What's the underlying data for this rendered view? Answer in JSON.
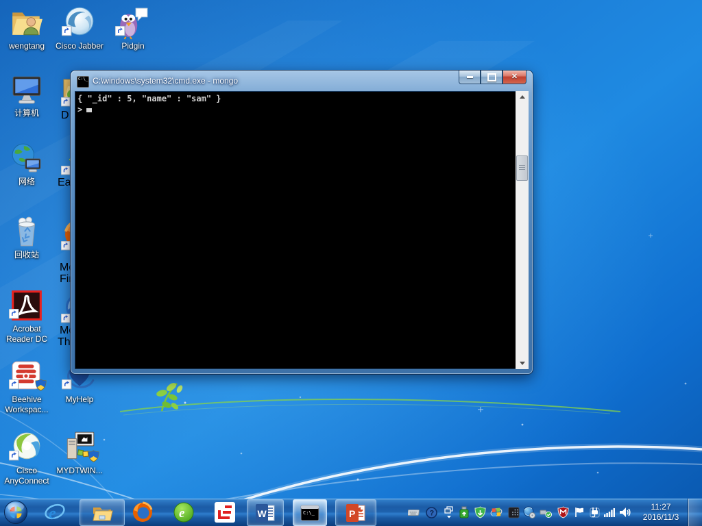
{
  "desktop_icons": [
    {
      "name": "wengtang",
      "label": "wengtang"
    },
    {
      "name": "cisco-jabber",
      "label": "Cisco Jabber"
    },
    {
      "name": "pidgin",
      "label": "Pidgin"
    },
    {
      "name": "computer",
      "label": "计算机"
    },
    {
      "name": "network",
      "label": "网络"
    },
    {
      "name": "recycle-bin",
      "label": "回收站"
    },
    {
      "name": "acrobat-reader-dc",
      "label": "Acrobat Reader DC"
    },
    {
      "name": "beehive-workspace",
      "label": "Beehive Workspac..."
    },
    {
      "name": "cisco-anyconnect",
      "label": "Cisco AnyConnect"
    },
    {
      "name": "myhelp",
      "label": "MyHelp"
    },
    {
      "name": "mydtwin",
      "label": "MYDTWIN..."
    }
  ],
  "partial_icons": [
    {
      "name": "hidden-item-d",
      "label": "D"
    },
    {
      "name": "hidden-item-eas",
      "label": "Eas"
    },
    {
      "name": "mozilla-firefox",
      "label_line1": "Mozilla",
      "label_line2": "Firefox"
    },
    {
      "name": "mozilla-thunderbird",
      "label_line1": "Mozilla",
      "label_line2": "Thunderbird"
    }
  ],
  "cmd_window": {
    "title": "C:\\windows\\system32\\cmd.exe - mongo",
    "line1": "{ \"_id\" : 5, \"name\" : \"sam\" }",
    "prompt": ">"
  },
  "glyphs": {
    "cmd_icon_text": "C:\\_",
    "ie": "e",
    "green_browser": "e",
    "word": "W",
    "powerpoint": "P",
    "help": "?"
  },
  "taskbar": {
    "items": [
      "start",
      "internet-explorer",
      "windows-explorer",
      "firefox",
      "green-browser",
      "letv",
      "word",
      "cmd",
      "powerpoint"
    ],
    "active_item": "cmd",
    "running_items": [
      "windows-explorer",
      "word",
      "cmd",
      "powerpoint"
    ]
  },
  "tray": {
    "icons": [
      "keyboard",
      "help",
      "show-hidden-icons",
      "usb-drive",
      "security-shield",
      "windows-update",
      "remote-desktop",
      "network-globe",
      "safely-remove-hardware",
      "mcafee",
      "action-center-flag",
      "power-plug",
      "network-signal",
      "volume"
    ],
    "time": "11:27",
    "date": "2016/11/3"
  },
  "colors": {
    "wallpaper_blue": "#1375d6",
    "taskbar_blue": "#1d61ad",
    "console_bg": "#000000",
    "console_text": "#d4d4d4",
    "close_button_red": "#c0402f",
    "accent_green_curve": "#86d14a"
  }
}
